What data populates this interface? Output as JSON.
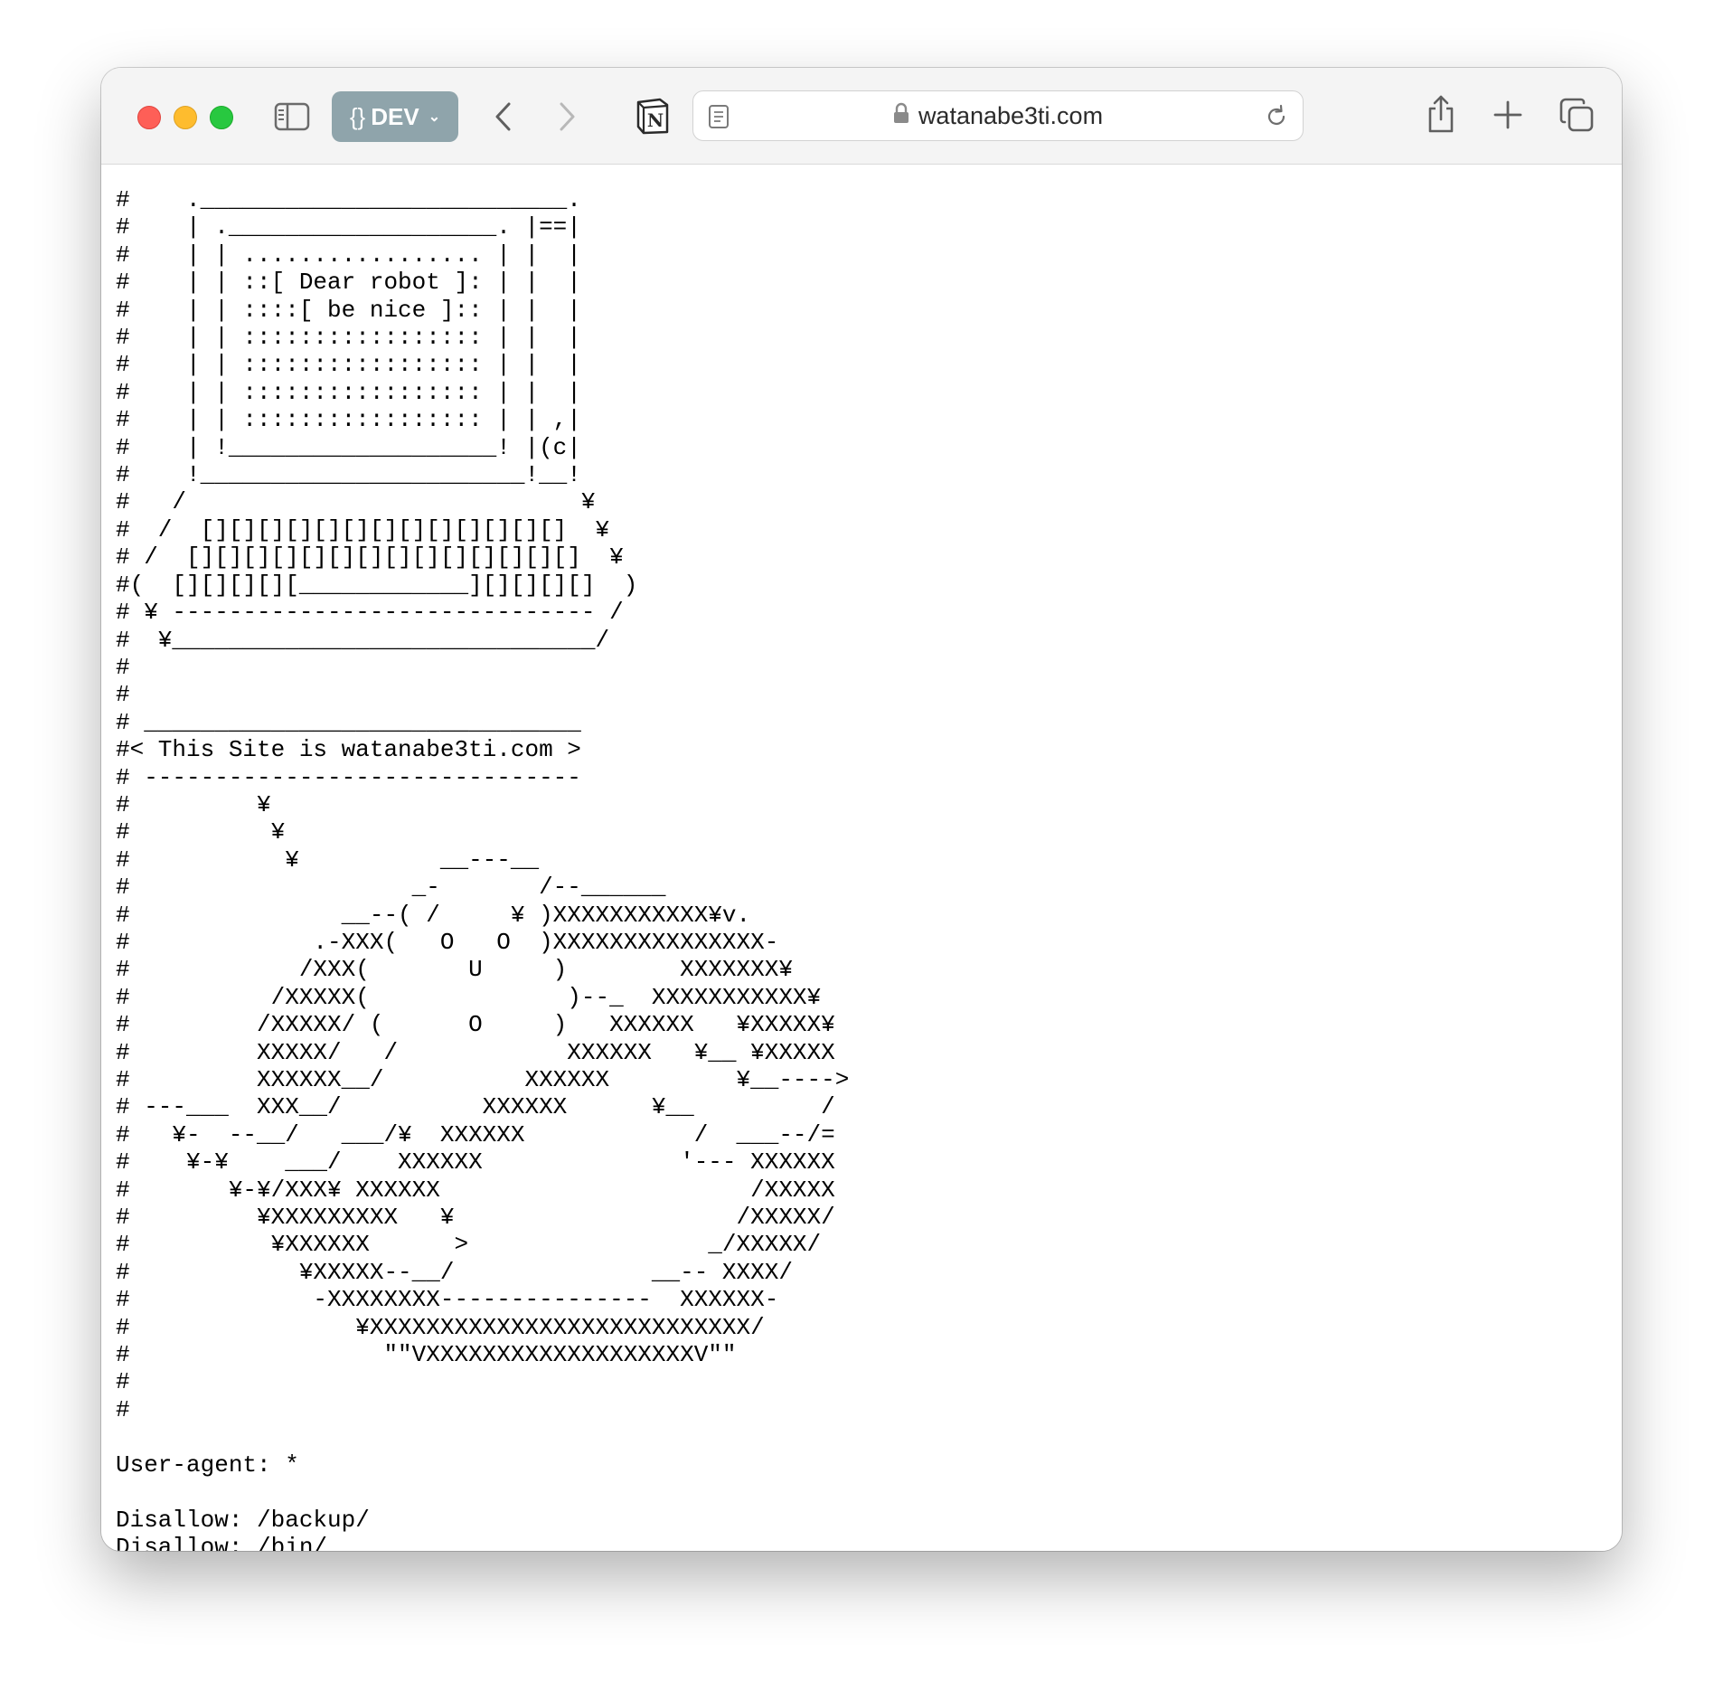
{
  "browser": {
    "dev_button": {
      "braces": "{}",
      "label": "DEV"
    },
    "url": "watanabe3ti.com"
  },
  "page": {
    "lines": [
      "#    .__________________________.",
      "#    | .___________________. |==|",
      "#    | | ................. | |  |",
      "#    | | ::[ Dear robot ]: | |  |",
      "#    | | ::::[ be nice ]:: | |  |",
      "#    | | ::::::::::::::::: | |  |",
      "#    | | ::::::::::::::::: | |  |",
      "#    | | ::::::::::::::::: | |  |",
      "#    | | ::::::::::::::::: | | ,|",
      "#    | !___________________! |(c|",
      "#    !_______________________!__!",
      "#   /                            ¥",
      "#  /  [][][][][][][][][][][][][]  ¥",
      "# /  [][][][][][][][][][][][][][]  ¥",
      "#(  [][][][][____________][][][][]  )",
      "# ¥ ------------------------------ /",
      "#  ¥______________________________/",
      "#",
      "#",
      "# _______________________________",
      "#< This Site is watanabe3ti.com >",
      "# -------------------------------",
      "#         ¥",
      "#          ¥",
      "#           ¥          __---__",
      "#                    _-       /--______",
      "#               __--( /     ¥ )XXXXXXXXXXX¥v.",
      "#             .-XXX(   O   O  )XXXXXXXXXXXXXXX-",
      "#            /XXX(       U     )        XXXXXXX¥",
      "#          /XXXXX(              )--_  XXXXXXXXXXX¥",
      "#         /XXXXX/ (      O     )   XXXXXX   ¥XXXXX¥",
      "#         XXXXX/   /            XXXXXX   ¥__ ¥XXXXX",
      "#         XXXXXX__/          XXXXXX         ¥__---->",
      "# ---___  XXX__/          XXXXXX      ¥__         /",
      "#   ¥-  --__/   ___/¥  XXXXXX            /  ___--/=",
      "#    ¥-¥    ___/    XXXXXX              '--- XXXXXX",
      "#       ¥-¥/XXX¥ XXXXXX                      /XXXXX",
      "#         ¥XXXXXXXXX   ¥                    /XXXXX/",
      "#          ¥XXXXXX      >                 _/XXXXX/",
      "#            ¥XXXXX--__/              __-- XXXX/",
      "#             -XXXXXXXX---------------  XXXXXX-",
      "#                ¥XXXXXXXXXXXXXXXXXXXXXXXXXXX/",
      "#                  \"\"VXXXXXXXXXXXXXXXXXXXV\"\"",
      "#",
      "#",
      "",
      "User-agent: *",
      "",
      "Disallow: /backup/",
      "Disallow: /bin/"
    ]
  }
}
